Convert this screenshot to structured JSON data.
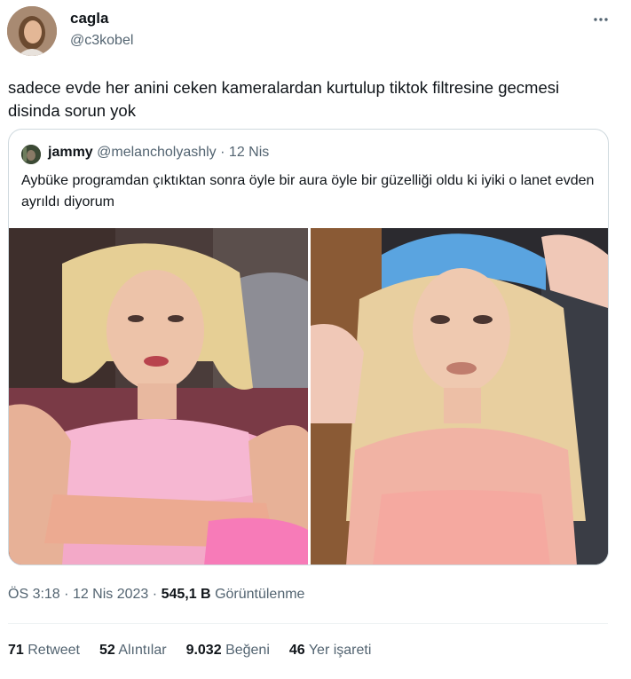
{
  "author": {
    "name": "cagla",
    "handle": "@c3kobel"
  },
  "tweet": {
    "text": "sadece evde her anini ceken kameralardan kurtulup tiktok filtresine gecmesi disinda sorun yok"
  },
  "quoted": {
    "name": "jammy",
    "handle": "@melancholyashly",
    "separator": "·",
    "date": "12 Nis",
    "text": "Aybüke programdan çıktıktan sonra öyle bir aura öyle bir güzelliği oldu ki iyiki o lanet evden ayrıldı diyorum"
  },
  "meta": {
    "time": "ÖS 3:18",
    "separator1": "·",
    "date": "12 Nis 2023",
    "separator2": "·",
    "views_count": "545,1 B",
    "views_label": "Görüntülenme"
  },
  "stats": [
    {
      "count": "71",
      "label": "Retweet"
    },
    {
      "count": "52",
      "label": "Alıntılar"
    },
    {
      "count": "9.032",
      "label": "Beğeni"
    },
    {
      "count": "46",
      "label": "Yer işareti"
    }
  ],
  "colors": {
    "text": "#0f1419",
    "secondary": "#536471",
    "border": "#cfd9de",
    "divider": "#eff3f4"
  },
  "icons": {
    "more": "more-horizontal-icon"
  }
}
